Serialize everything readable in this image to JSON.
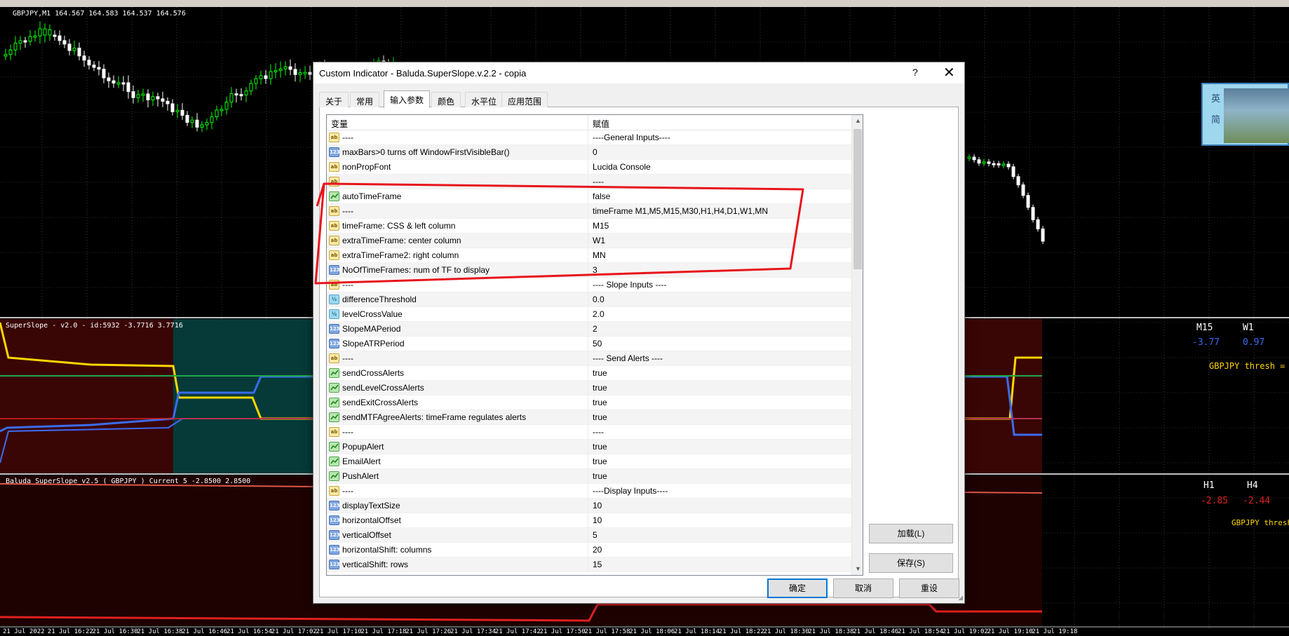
{
  "chart": {
    "main_label": "GBPJPY,M1  164.567 164.583 164.537 164.576",
    "indicator1_label": "SuperSlope - v2.0 - id:5932 -3.7716 3.7716",
    "indicator2_label": "Baluda SuperSlope_v2.5 ( GBPJPY ) Current 5 -2.8500 2.8500",
    "mtf_top": {
      "headers": [
        "M15",
        "W1"
      ],
      "values": [
        "-3.77",
        "0.97"
      ],
      "thresh": "GBPJPY thresh ="
    },
    "mtf_bottom": {
      "headers": [
        "H1",
        "H4"
      ],
      "values": [
        "-2.85",
        "-2.44"
      ],
      "thresh": "GBPJPY thresh ="
    },
    "time_axis": [
      "21 Jul 2022",
      "21 Jul 16:22",
      "21 Jul 16:30",
      "21 Jul 16:38",
      "21 Jul 16:46",
      "21 Jul 16:54",
      "21 Jul 17:02",
      "21 Jul 17:10",
      "21 Jul 17:18",
      "21 Jul 17:26",
      "21 Jul 17:34",
      "21 Jul 17:42",
      "21 Jul 17:50",
      "21 Jul 17:58",
      "21 Jul 18:06",
      "21 Jul 18:14",
      "21 Jul 18:22",
      "21 Jul 18:30",
      "21 Jul 18:38",
      "21 Jul 18:46",
      "21 Jul 18:54",
      "21 Jul 19:02",
      "21 Jul 19:10",
      "21 Jul 19:18"
    ],
    "colors": {
      "bull": "#00ff00",
      "bear": "#ffffff",
      "yellow": "#ffd700",
      "blue": "#3a6cf0",
      "red": "#e02020",
      "green": "#21a84a",
      "panel_red": "#3a0505",
      "panel_teal": "#053a38"
    }
  },
  "dialog": {
    "title": "Custom Indicator - Baluda.SuperSlope.v.2.2 - copia",
    "help": "?",
    "close": "✕",
    "tabs": [
      "关于",
      "常用",
      "输入参数",
      "颜色",
      "水平位",
      "应用范围"
    ],
    "active_tab": 2,
    "grid": {
      "headers": [
        "变量",
        "赋值"
      ],
      "rows": [
        {
          "type": "ab",
          "name": "----",
          "value": "----General Inputs----"
        },
        {
          "type": "123",
          "name": "maxBars>0 turns off WindowFirstVisibleBar()",
          "value": "0"
        },
        {
          "type": "ab",
          "name": "nonPropFont",
          "value": "Lucida Console"
        },
        {
          "type": "ab",
          "name": "",
          "value": "----"
        },
        {
          "type": "bool",
          "name": "autoTimeFrame",
          "value": "false"
        },
        {
          "type": "ab",
          "name": "----",
          "value": "timeFrame M1,M5,M15,M30,H1,H4,D1,W1,MN"
        },
        {
          "type": "ab",
          "name": "timeFrame: CSS & left column",
          "value": "M15"
        },
        {
          "type": "ab",
          "name": "extraTimeFrame: center column",
          "value": "W1"
        },
        {
          "type": "ab",
          "name": "extraTimeFrame2: right column",
          "value": "MN"
        },
        {
          "type": "123",
          "name": "NoOfTimeFrames: num of TF to display",
          "value": "3"
        },
        {
          "type": "ab",
          "name": "----",
          "value": "---- Slope Inputs ----"
        },
        {
          "type": "dbl",
          "name": "differenceThreshold",
          "value": "0.0"
        },
        {
          "type": "dbl",
          "name": "levelCrossValue",
          "value": "2.0"
        },
        {
          "type": "123",
          "name": "SlopeMAPeriod",
          "value": "2"
        },
        {
          "type": "123",
          "name": "SlopeATRPeriod",
          "value": "50"
        },
        {
          "type": "ab",
          "name": "----",
          "value": "---- Send Alerts ----"
        },
        {
          "type": "bool",
          "name": "sendCrossAlerts",
          "value": "true"
        },
        {
          "type": "bool",
          "name": "sendLevelCrossAlerts",
          "value": "true"
        },
        {
          "type": "bool",
          "name": "sendExitCrossAlerts",
          "value": "true"
        },
        {
          "type": "bool",
          "name": "sendMTFAgreeAlerts: timeFrame regulates alerts",
          "value": "true"
        },
        {
          "type": "ab",
          "name": "----",
          "value": "----"
        },
        {
          "type": "bool",
          "name": "PopupAlert",
          "value": "true"
        },
        {
          "type": "bool",
          "name": "EmailAlert",
          "value": "true"
        },
        {
          "type": "bool",
          "name": "PushAlert",
          "value": "true"
        },
        {
          "type": "ab",
          "name": "----",
          "value": "----Display Inputs----"
        },
        {
          "type": "123",
          "name": "displayTextSize",
          "value": "10"
        },
        {
          "type": "123",
          "name": "horizontalOffset",
          "value": "10"
        },
        {
          "type": "123",
          "name": "verticalOffset",
          "value": "5"
        },
        {
          "type": "123",
          "name": "horizontalShift: columns",
          "value": "20"
        },
        {
          "type": "123",
          "name": "verticalShift: rows",
          "value": "15"
        }
      ]
    },
    "icon_text": {
      "ab": "ab",
      "123": "123",
      "dbl": "½"
    },
    "side_buttons": {
      "load": "加载(L)",
      "save": "保存(S)"
    },
    "footer_buttons": {
      "ok": "确定",
      "cancel": "取消",
      "reset": "重设"
    }
  },
  "ime": {
    "chars": [
      "英",
      "简"
    ]
  }
}
